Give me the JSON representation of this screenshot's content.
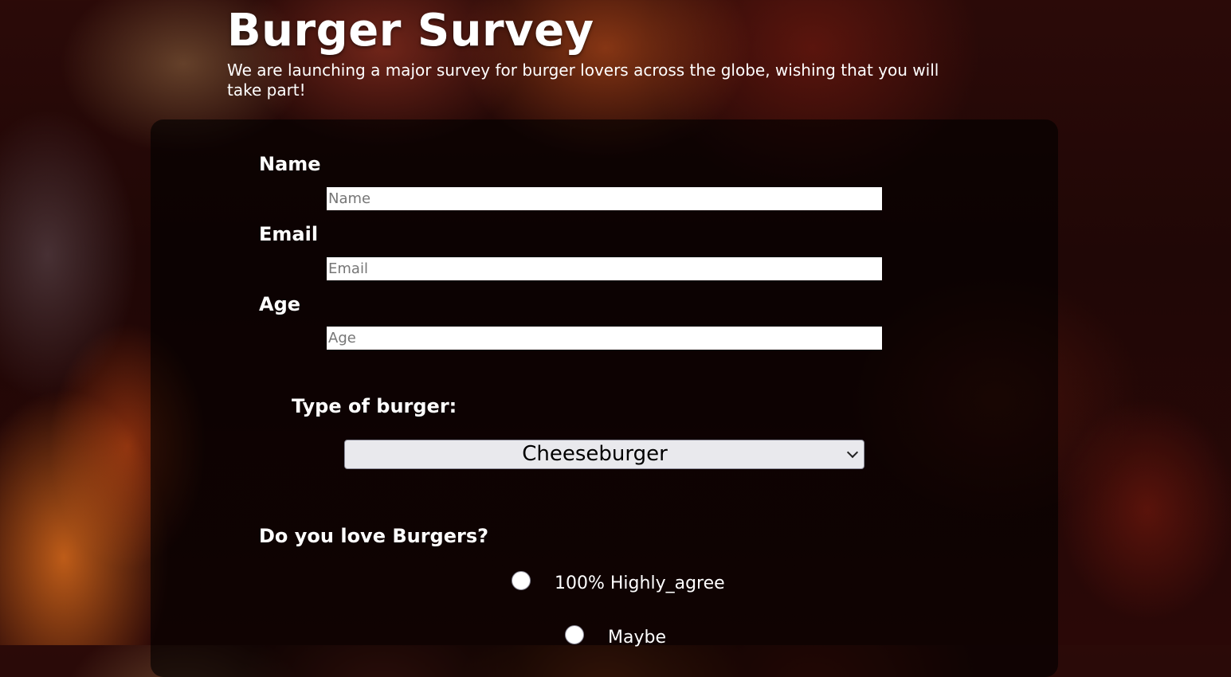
{
  "header": {
    "title": "Burger Survey",
    "description": "We are launching a major survey for burger lovers across the globe, wishing that you will take part!"
  },
  "form": {
    "name": {
      "label": "Name",
      "placeholder": "Name",
      "value": ""
    },
    "email": {
      "label": "Email",
      "placeholder": "Email",
      "value": ""
    },
    "age": {
      "label": "Age",
      "placeholder": "Age",
      "value": ""
    },
    "burger_type": {
      "label": "Type of burger:",
      "selected": "Cheeseburger"
    },
    "love_burgers": {
      "question": "Do you love Burgers?",
      "options": [
        {
          "label": "100% Highly_agree",
          "checked": false
        },
        {
          "label": "Maybe",
          "checked": false
        }
      ]
    }
  },
  "icons": {
    "select_arrow": "chevron-down-icon"
  },
  "colors": {
    "input_background": "#ffffff",
    "select_background": "#e9e9ed",
    "text": "#ffffff"
  }
}
